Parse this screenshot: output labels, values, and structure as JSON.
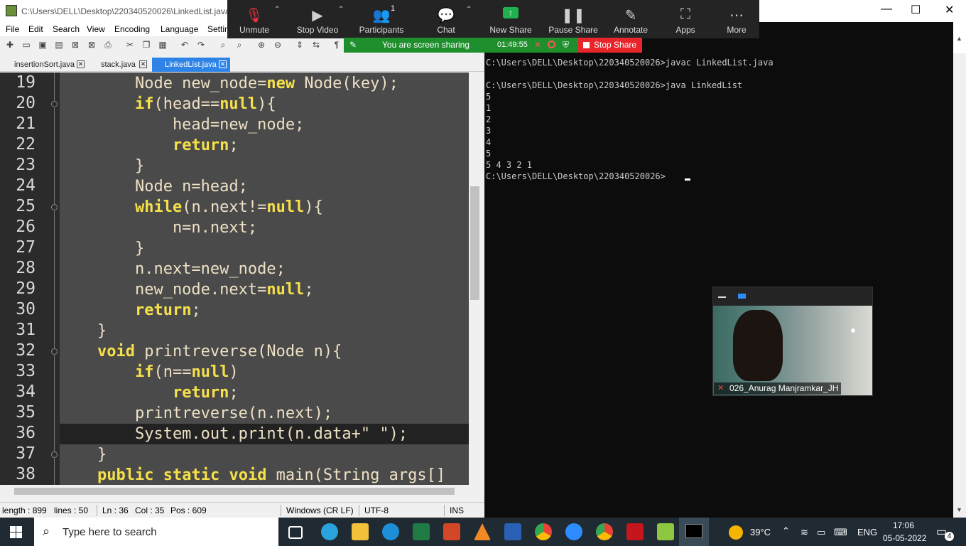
{
  "npp": {
    "title": "C:\\Users\\DELL\\Desktop\\220340520026\\LinkedList.java -",
    "menu": [
      "File",
      "Edit",
      "Search",
      "View",
      "Encoding",
      "Language",
      "Settir"
    ],
    "tabs": [
      {
        "label": "insertionSort.java",
        "active": false
      },
      {
        "label": "stack.java",
        "active": false
      },
      {
        "label": "LinkedList.java",
        "active": true
      }
    ],
    "line_numbers": [
      "19",
      "20",
      "21",
      "22",
      "23",
      "24",
      "25",
      "26",
      "27",
      "28",
      "29",
      "30",
      "31",
      "32",
      "33",
      "34",
      "35",
      "36",
      "37",
      "38"
    ],
    "status": {
      "length": "length : 899",
      "lines": "lines : 50",
      "ln": "Ln : 36",
      "col": "Col : 35",
      "pos": "Pos : 609",
      "eol": "Windows (CR LF)",
      "encoding": "UTF-8",
      "mode": "INS"
    }
  },
  "zoom": {
    "buttons": [
      "Unmute",
      "Stop Video",
      "Participants",
      "Chat",
      "New Share",
      "Pause Share",
      "Annotate",
      "Apps",
      "More"
    ],
    "participants_count": "1",
    "sharing_text": "You are screen sharing",
    "sharing_time": "01:49:55",
    "stop_share": "Stop Share",
    "video_name": "026_Anurag Manjramkar_JH"
  },
  "cmd": {
    "output": "C:\\Users\\DELL\\Desktop\\220340520026>javac LinkedList.java\n\nC:\\Users\\DELL\\Desktop\\220340520026>java LinkedList\n5\n1\n2\n3\n4\n5\n5 4 3 2 1\nC:\\Users\\DELL\\Desktop\\220340520026>"
  },
  "taskbar": {
    "search_placeholder": "Type here to search",
    "temperature": "39°C",
    "language": "ENG",
    "time": "17:06",
    "date": "05-05-2022",
    "notifications": "4"
  },
  "window_controls": {
    "minimize": "—",
    "maximize": "☐",
    "close": "✕"
  }
}
